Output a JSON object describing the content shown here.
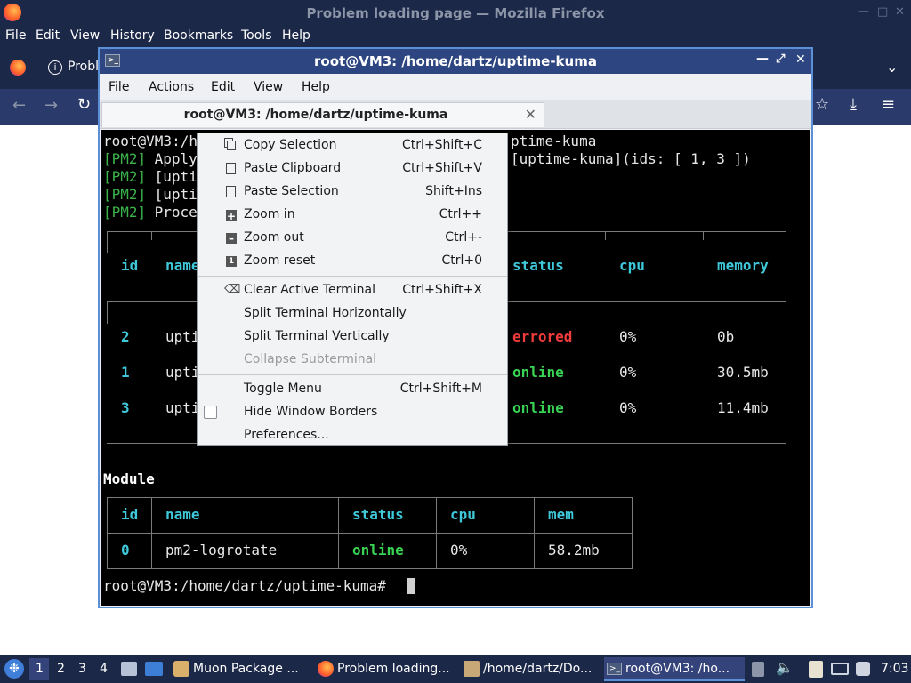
{
  "firefox": {
    "title": "Problem loading page — Mozilla Firefox",
    "menu": [
      "File",
      "Edit",
      "View",
      "History",
      "Bookmarks",
      "Tools",
      "Help"
    ],
    "tab_label": "Probl"
  },
  "terminal": {
    "title": "root@VM3: /home/dartz/uptime-kuma",
    "menu": [
      "File",
      "Actions",
      "Edit",
      "View",
      "Help"
    ],
    "tab_title": "root@VM3: /home/dartz/uptime-kuma",
    "lines": {
      "cmd": "root@VM3:/h",
      "cmd_tail": "ptime-kuma",
      "pm2_1_pre": "[PM2]",
      "pm2_1_txt": " Apply",
      "pm2_1_tail": "[uptime-kuma](ids: [ 1, 3 ])",
      "pm2_2_pre": "[PM2]",
      "pm2_2_txt": " [upti",
      "pm2_3_pre": "[PM2]",
      "pm2_3_txt": " [upti",
      "pm2_4_pre": "[PM2]",
      "pm2_4_txt": " Proce"
    },
    "process_table": {
      "headers": {
        "id": "id",
        "name": "name",
        "status": "status",
        "cpu": "cpu",
        "memory": "memory"
      },
      "rows": [
        {
          "id": "2",
          "name": "upti",
          "status": "errored",
          "cpu": "0%",
          "memory": "0b"
        },
        {
          "id": "1",
          "name": "upti",
          "status": "online",
          "cpu": "0%",
          "memory": "30.5mb"
        },
        {
          "id": "3",
          "name": "upti",
          "status": "online",
          "cpu": "0%",
          "memory": "11.4mb"
        }
      ]
    },
    "module_title": "Module",
    "module_table": {
      "headers": {
        "id": "id",
        "name": "name",
        "status": "status",
        "cpu": "cpu",
        "mem": "mem"
      },
      "row": {
        "id": "0",
        "name": "pm2-logrotate",
        "status": "online",
        "cpu": "0%",
        "mem": "58.2mb"
      }
    },
    "prompt": "root@VM3:/home/dartz/uptime-kuma#"
  },
  "context_menu": {
    "items": [
      {
        "label": "Copy Selection",
        "shortcut": "Ctrl+Shift+C"
      },
      {
        "label": "Paste Clipboard",
        "shortcut": "Ctrl+Shift+V"
      },
      {
        "label": "Paste Selection",
        "shortcut": "Shift+Ins"
      },
      {
        "label": "Zoom in",
        "shortcut": "Ctrl++"
      },
      {
        "label": "Zoom out",
        "shortcut": "Ctrl+-"
      },
      {
        "label": "Zoom reset",
        "shortcut": "Ctrl+0"
      },
      {
        "label": "Clear Active Terminal",
        "shortcut": "Ctrl+Shift+X"
      },
      {
        "label": "Split Terminal Horizontally",
        "shortcut": ""
      },
      {
        "label": "Split Terminal Vertically",
        "shortcut": ""
      },
      {
        "label": "Collapse Subterminal",
        "shortcut": ""
      },
      {
        "label": "Toggle Menu",
        "shortcut": "Ctrl+Shift+M"
      },
      {
        "label": "Hide Window Borders",
        "shortcut": ""
      },
      {
        "label": "Preferences...",
        "shortcut": ""
      }
    ]
  },
  "taskbar": {
    "workspaces": [
      "1",
      "2",
      "3",
      "4"
    ],
    "tasks": [
      {
        "label": "Muon Package ..."
      },
      {
        "label": "Problem loading..."
      },
      {
        "label": "/home/dartz/Do..."
      },
      {
        "label": "root@VM3: /ho..."
      }
    ],
    "clock": "7:03"
  },
  "colors": {
    "terminal_bg": "#000000",
    "pm2_green": "#3bb34a",
    "header_cyan": "#3ec8d9",
    "status_online": "#39d353",
    "status_errored": "#ef3b3b",
    "titlebar_blue": "#2d4580"
  }
}
